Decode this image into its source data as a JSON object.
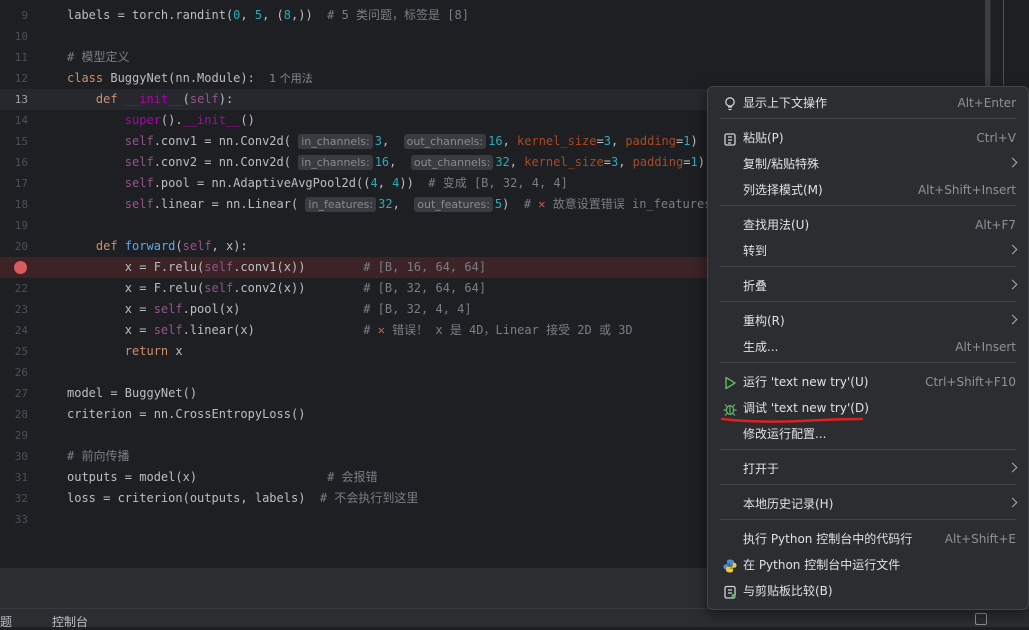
{
  "editor": {
    "lines": [
      {
        "n": "9",
        "html": "labels = torch.randint(<span class=\"num\">0</span>, <span class=\"num\">5</span>, (<span class=\"num\">8</span>,))  <span class=\"cm\"># 5 类问题，标签是 [8]</span>"
      },
      {
        "n": "10",
        "html": ""
      },
      {
        "n": "11",
        "html": "<span class=\"cm\"># 模型定义</span>"
      },
      {
        "n": "12",
        "html": "<span class=\"kw\">class</span> BuggyNet(nn.Module):  <span class=\"hint\">1 个用法</span>"
      },
      {
        "n": "13",
        "html": "    <span class=\"kw\">def</span> <span class=\"dun\">__init__</span>(<span class=\"slf\">self</span>):"
      },
      {
        "n": "14",
        "html": "        <span class=\"dun\">super</span>().<span class=\"dun\">__init__</span>()"
      },
      {
        "n": "15",
        "html": "        <span class=\"slf\">self</span>.conv1 = nn.Conv2d( <span class=\"ih\">in_channels:</span><span class=\"num\">3</span>,  <span class=\"ih\">out_channels:</span><span class=\"num\">16</span>, <span class=\"kwarg\">kernel_size</span>=<span class=\"num\">3</span>, <span class=\"kwarg\">padding</span>=<span class=\"num\">1</span>)"
      },
      {
        "n": "16",
        "html": "        <span class=\"slf\">self</span>.conv2 = nn.Conv2d( <span class=\"ih\">in_channels:</span><span class=\"num\">16</span>,  <span class=\"ih\">out_channels:</span><span class=\"num\">32</span>, <span class=\"kwarg\">kernel_size</span>=<span class=\"num\">3</span>, <span class=\"kwarg\">padding</span>=<span class=\"num\">1</span>)"
      },
      {
        "n": "17",
        "html": "        <span class=\"slf\">self</span>.pool = nn.AdaptiveAvgPool2d((<span class=\"num\">4</span>, <span class=\"num\">4</span>))  <span class=\"cm\"># 变成 [B, 32, 4, 4]</span>"
      },
      {
        "n": "18",
        "html": "        <span class=\"slf\">self</span>.linear = nn.Linear( <span class=\"ih\">in_features:</span><span class=\"num\">32</span>,  <span class=\"ih\">out_features:</span><span class=\"num\">5</span>)  <span class=\"cm\"># <span class=\"xmark\">✕</span> 故意设置错误 in_features</span>"
      },
      {
        "n": "19",
        "html": ""
      },
      {
        "n": "20",
        "html": "    <span class=\"kw\">def</span> <span class=\"fn\">forward</span>(<span class=\"slf\">self</span>, x):"
      },
      {
        "n": "21",
        "html": "        x = F.relu(<span class=\"slf\">self</span>.conv1(x))        <span class=\"cm\"># [B, 16, 64, 64]</span>"
      },
      {
        "n": "22",
        "html": "        x = F.relu(<span class=\"slf\">self</span>.conv2(x))        <span class=\"cm\"># [B, 32, 64, 64]</span>"
      },
      {
        "n": "23",
        "html": "        x = <span class=\"slf\">self</span>.pool(x)                 <span class=\"cm\"># [B, 32, 4, 4]</span>"
      },
      {
        "n": "24",
        "html": "        x = <span class=\"slf\">self</span>.linear(x)               <span class=\"cm\"># <span class=\"xmark\">✕</span> 错误！ x 是 4D，Linear 接受 2D 或 3D</span>"
      },
      {
        "n": "25",
        "html": "        <span class=\"kw\">return</span> x"
      },
      {
        "n": "26",
        "html": ""
      },
      {
        "n": "27",
        "html": "model = BuggyNet()"
      },
      {
        "n": "28",
        "html": "criterion = nn.CrossEntropyLoss()"
      },
      {
        "n": "29",
        "html": ""
      },
      {
        "n": "30",
        "html": "<span class=\"cm\"># 前向传播</span>"
      },
      {
        "n": "31",
        "html": "outputs = model(x)                  <span class=\"cm\"># 会报错</span>"
      },
      {
        "n": "32",
        "html": "loss = criterion(outputs, labels)  <span class=\"cm\"># 不会执行到这里</span>"
      },
      {
        "n": "33",
        "html": ""
      }
    ]
  },
  "bottom_tabs": [
    "问题",
    "控制台"
  ],
  "context_menu": {
    "items": [
      {
        "label": "显示上下文操作",
        "shortcut": "Alt+Enter",
        "icon": "bulb-icon",
        "name": "menu-show-context-actions"
      },
      {
        "label": "粘贴(P)",
        "shortcut": "Ctrl+V",
        "icon": "clipboard-icon",
        "name": "menu-paste"
      },
      {
        "label": "复制/粘贴特殊",
        "submenu": true,
        "name": "menu-copy-paste-special"
      },
      {
        "label": "列选择模式(M)",
        "shortcut": "Alt+Shift+Insert",
        "name": "menu-column-selection"
      },
      {
        "label": "查找用法(U)",
        "shortcut": "Alt+F7",
        "name": "menu-find-usages"
      },
      {
        "label": "转到",
        "submenu": true,
        "name": "menu-goto"
      },
      {
        "label": "折叠",
        "submenu": true,
        "name": "menu-folding"
      },
      {
        "label": "重构(R)",
        "submenu": true,
        "name": "menu-refactor"
      },
      {
        "label": "生成...",
        "shortcut": "Alt+Insert",
        "name": "menu-generate"
      },
      {
        "label": "运行 'text new try'(U)",
        "shortcut": "Ctrl+Shift+F10",
        "icon": "run-icon",
        "name": "menu-run"
      },
      {
        "label": "调试 'text new try'(D)",
        "icon": "debug-icon",
        "name": "menu-debug"
      },
      {
        "label": "修改运行配置...",
        "name": "menu-modify-run-config"
      },
      {
        "label": "打开于",
        "submenu": true,
        "name": "menu-open-in"
      },
      {
        "label": "本地历史记录(H)",
        "submenu": true,
        "name": "menu-local-history"
      },
      {
        "label": "执行 Python 控制台中的代码行",
        "shortcut": "Alt+Shift+E",
        "name": "menu-exec-console-line"
      },
      {
        "label": "在 Python 控制台中运行文件",
        "icon": "python-icon",
        "name": "menu-run-file-console"
      },
      {
        "label": "与剪贴板比较(B)",
        "icon": "compare-icon",
        "name": "menu-compare-clipboard"
      }
    ]
  },
  "colors": {
    "accent_red": "#e02020",
    "run_green": "#5fb865",
    "menu_bg": "#2b2d30"
  }
}
